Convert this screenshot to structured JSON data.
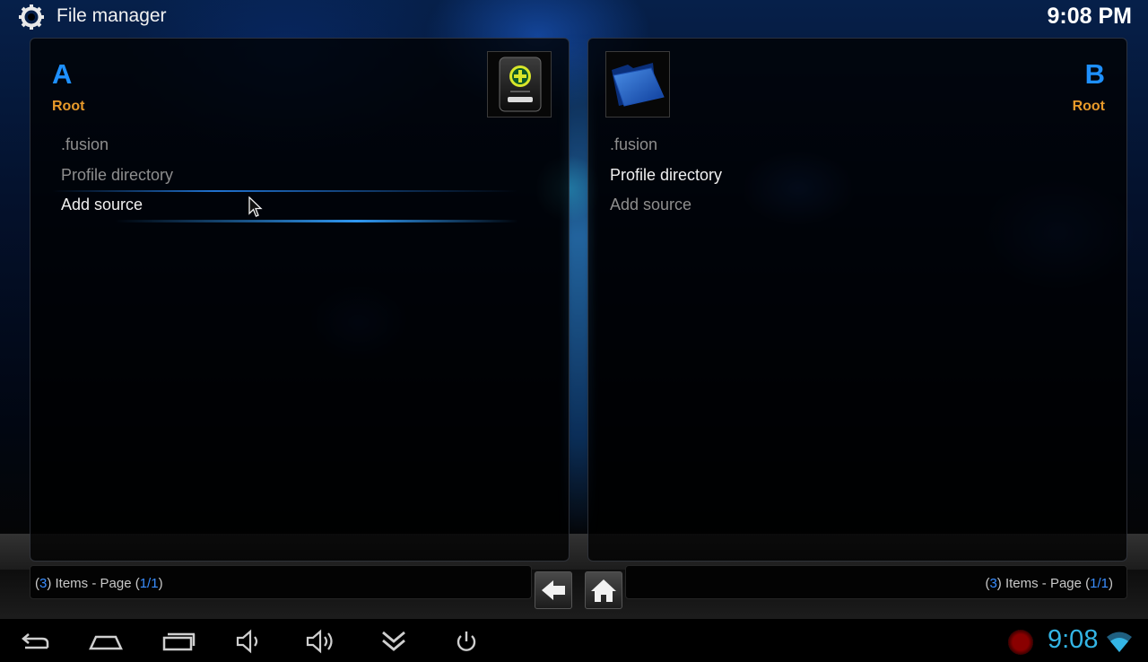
{
  "header": {
    "title": "File manager",
    "time": "9:08 PM",
    "icon": "gear-icon"
  },
  "panel_a": {
    "letter": "A",
    "path": "Root",
    "thumbnail_icon": "add-source-drive-icon",
    "items": [
      {
        "label": ".fusion",
        "style": "dim"
      },
      {
        "label": "Profile directory",
        "style": "dim"
      },
      {
        "label": "Add source",
        "style": "focused"
      }
    ],
    "footer": {
      "open": "(",
      "count": "3",
      "mid": ") Items - Page (",
      "page": "1/1",
      "close": ")"
    }
  },
  "panel_b": {
    "letter": "B",
    "path": "Root",
    "thumbnail_icon": "blue-folder-icon",
    "items": [
      {
        "label": ".fusion",
        "style": "dim"
      },
      {
        "label": "Profile directory",
        "style": "bright"
      },
      {
        "label": "Add source",
        "style": "dim"
      }
    ],
    "footer": {
      "open": "(",
      "count": "3",
      "mid": ") Items - Page (",
      "page": "1/1",
      "close": ")"
    }
  },
  "nav": {
    "back_icon": "back-arrow-icon",
    "home_icon": "home-icon"
  },
  "system_bar": {
    "time": "9:08",
    "icons": [
      "back-nav-icon",
      "home-nav-icon",
      "recent-apps-icon",
      "volume-down-icon",
      "volume-up-icon",
      "collapse-icon",
      "power-icon",
      "record-icon",
      "wifi-icon"
    ]
  },
  "colors": {
    "accent_blue": "#1e90ff",
    "path_orange": "#e89a2a",
    "system_time_blue": "#33b5e5"
  }
}
